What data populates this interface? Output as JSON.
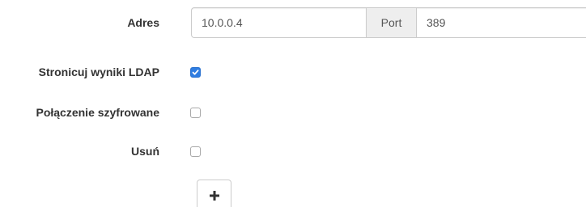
{
  "address_row": {
    "label": "Adres",
    "address_value": "10.0.0.4",
    "port_label": "Port",
    "port_value": "389"
  },
  "options": [
    {
      "label": "Stronicuj wyniki LDAP",
      "checked": true
    },
    {
      "label": "Połączenie szyfrowane",
      "checked": false
    },
    {
      "label": "Usuń",
      "checked": false
    }
  ],
  "add_button": {
    "icon": "plus-icon"
  },
  "colors": {
    "checkbox_checked": "#2f7de1",
    "addon_background": "#eeeeee",
    "border": "#cccccc"
  }
}
